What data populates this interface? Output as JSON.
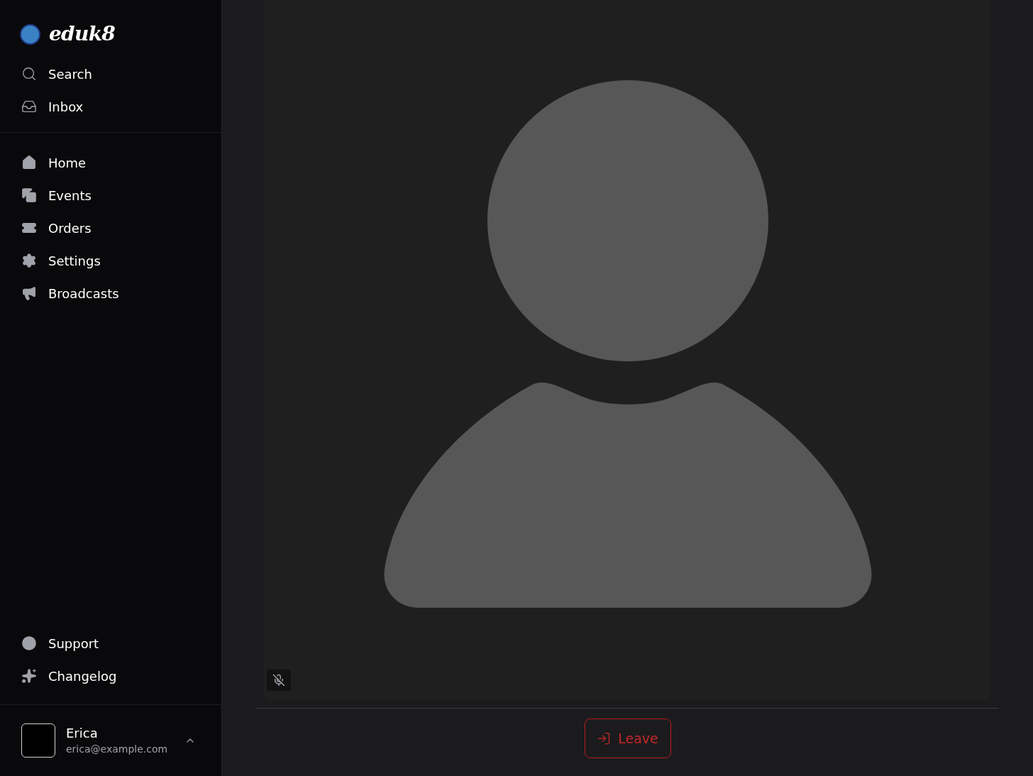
{
  "brand": {
    "name": "eduk8"
  },
  "top_nav": [
    {
      "label": "Search"
    },
    {
      "label": "Inbox"
    }
  ],
  "main_nav": [
    {
      "label": "Home"
    },
    {
      "label": "Events"
    },
    {
      "label": "Orders"
    },
    {
      "label": "Settings"
    },
    {
      "label": "Broadcasts"
    }
  ],
  "footer_nav": [
    {
      "label": "Support"
    },
    {
      "label": "Changelog"
    }
  ],
  "user": {
    "name": "Erica",
    "email": "erica@example.com"
  },
  "video_tile": {
    "muted": true
  },
  "leave_button": {
    "label": "Leave"
  }
}
